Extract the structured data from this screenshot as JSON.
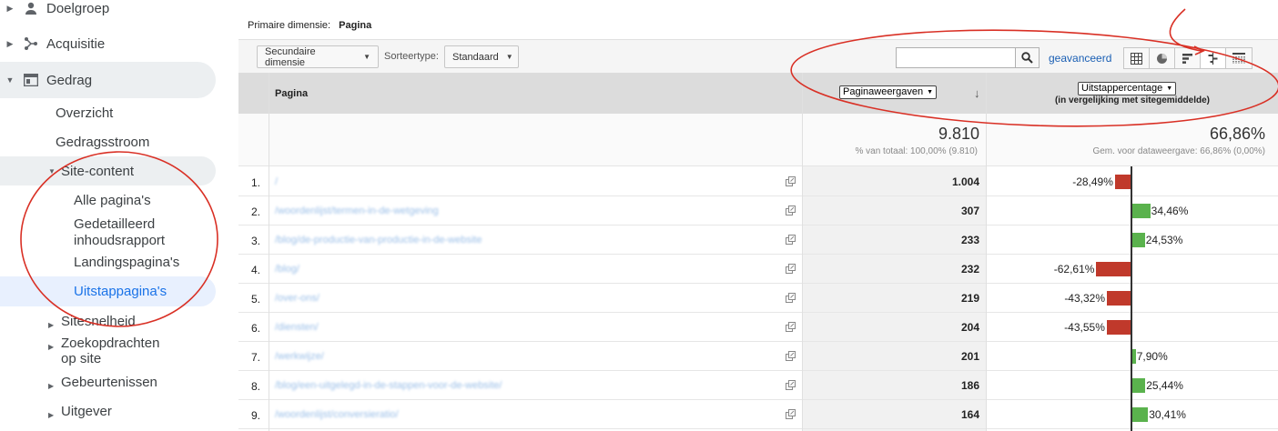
{
  "sidebar": {
    "top_items": [
      {
        "label": "Doelgroep",
        "icon": "person-icon"
      },
      {
        "label": "Acquisitie",
        "icon": "acquisition-icon"
      },
      {
        "label": "Gedrag",
        "icon": "behavior-icon"
      }
    ],
    "gedrag_children": [
      "Overzicht",
      "Gedragsstroom"
    ],
    "site_content": "Site-content",
    "site_content_children": [
      "Alle pagina's",
      "Gedetailleerd inhoudsrapport",
      "Landingspagina's"
    ],
    "selected": "Uitstappagina's",
    "other_children": [
      "Sitesnelheid",
      "Zoekopdrachten op site",
      "Gebeurtenissen",
      "Uitgever"
    ]
  },
  "header": {
    "primary_dimension_label": "Primaire dimensie:",
    "primary_dimension_value": "Pagina"
  },
  "toolbar": {
    "secondary_dimension": "Secundaire dimensie",
    "sort_type_label": "Sorteertype:",
    "sort_type_value": "Standaard",
    "search_placeholder": "",
    "advanced_link": "geavanceerd",
    "view_icons": [
      "table-view-icon",
      "pie-view-icon",
      "bar-view-icon",
      "comparison-view-icon",
      "pivot-view-icon"
    ]
  },
  "table": {
    "col_page": "Pagina",
    "col_metric1": "Paginaweergaven",
    "col_metric2": "Uitstappercentage",
    "col_metric2_sub": "(in vergelijking met sitegemiddelde)",
    "totals": {
      "pv": "9.810",
      "pv_sub": "% van totaal: 100,00% (9.810)",
      "exit": "66,86%",
      "exit_sub": "Gem. voor dataweergave: 66,86% (0,00%)"
    },
    "rows": [
      {
        "idx": "1.",
        "page": "/",
        "pv": "1.004",
        "pct": "-28,49%",
        "value": -28.49
      },
      {
        "idx": "2.",
        "page": "/woordenlijst/termen-in-de-wetgeving",
        "pv": "307",
        "pct": "34,46%",
        "value": 34.46
      },
      {
        "idx": "3.",
        "page": "/blog/de-productie-van-productie-in-de-website",
        "pv": "233",
        "pct": "24,53%",
        "value": 24.53
      },
      {
        "idx": "4.",
        "page": "/blog/",
        "pv": "232",
        "pct": "-62,61%",
        "value": -62.61
      },
      {
        "idx": "5.",
        "page": "/over-ons/",
        "pv": "219",
        "pct": "-43,32%",
        "value": -43.32
      },
      {
        "idx": "6.",
        "page": "/diensten/",
        "pv": "204",
        "pct": "-43,55%",
        "value": -43.55
      },
      {
        "idx": "7.",
        "page": "/werkwijze/",
        "pv": "201",
        "pct": "7,90%",
        "value": 7.9
      },
      {
        "idx": "8.",
        "page": "/blog/een-uitgelegd-in-de-stappen-voor-de-website/",
        "pv": "186",
        "pct": "25,44%",
        "value": 25.44
      },
      {
        "idx": "9.",
        "page": "/woordenlijst/conversieratio/",
        "pv": "164",
        "pct": "30,41%",
        "value": 30.41
      }
    ]
  },
  "colors": {
    "positive": "#5ab24d",
    "negative": "#c0392b",
    "annotation": "#d93025",
    "selected_nav": "#1a73e8"
  }
}
